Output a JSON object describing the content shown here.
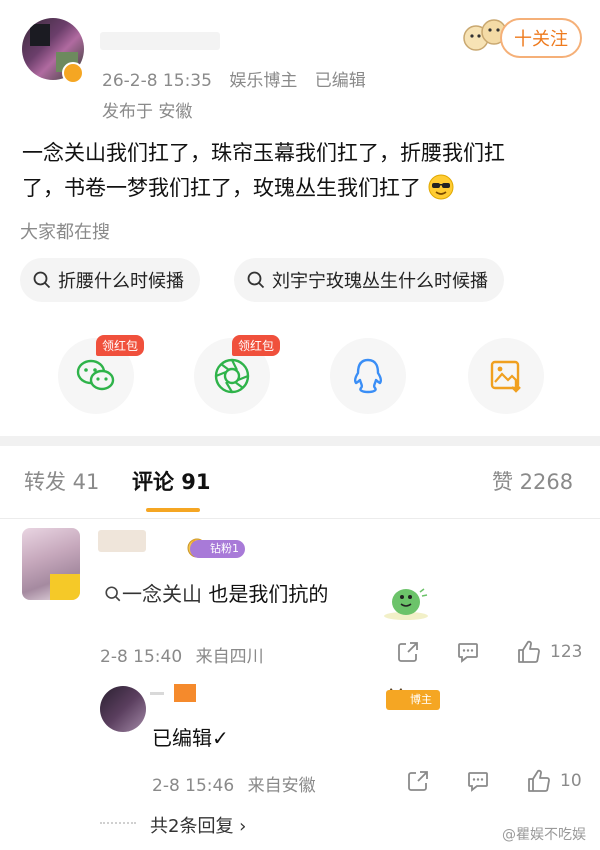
{
  "post": {
    "timestamp": "26-2-8 15:35",
    "source": "娱乐博主",
    "edited": "已编辑",
    "location": "发布于 安徽",
    "follow_label": "十关注",
    "text_line1": "一念关山我们扛了，珠帘玉幕我们扛了，折腰我们扛",
    "text_line2": "了，书卷一梦我们扛了，玫瑰丛生我们扛了",
    "emoji": "sunglasses-emoji"
  },
  "search": {
    "title": "大家都在搜",
    "chips": [
      "折腰什么时候播",
      "刘宇宁玫瑰丛生什么时候播"
    ]
  },
  "share": {
    "red_tag": "领红包",
    "items": [
      "wechat-icon",
      "moments-icon",
      "qq-icon",
      "save-image-icon"
    ]
  },
  "tabs": {
    "repost": "转发 41",
    "comments": "评论 91",
    "likes": "赞 2268"
  },
  "comment": {
    "badge": "钻粉1",
    "text_prefix": "一念关山",
    "text_suffix": " 也是我们抗的",
    "time": "2-8 15:40",
    "from": "来自四川",
    "like_count": "123"
  },
  "reply": {
    "badge": "博主",
    "text": "已编辑✓",
    "time": "2-8 15:46",
    "from": "来自安徽",
    "like_count": "10",
    "more_replies": "共2条回复 ›"
  },
  "watermark": "@瞿娱不吃娱",
  "colors": {
    "accent_orange": "#ee7a1d",
    "wechat_green": "#2fb34a",
    "qq_blue": "#3a8ef6",
    "tab_underline": "#f5a623",
    "red_tag": "#f0503c"
  }
}
